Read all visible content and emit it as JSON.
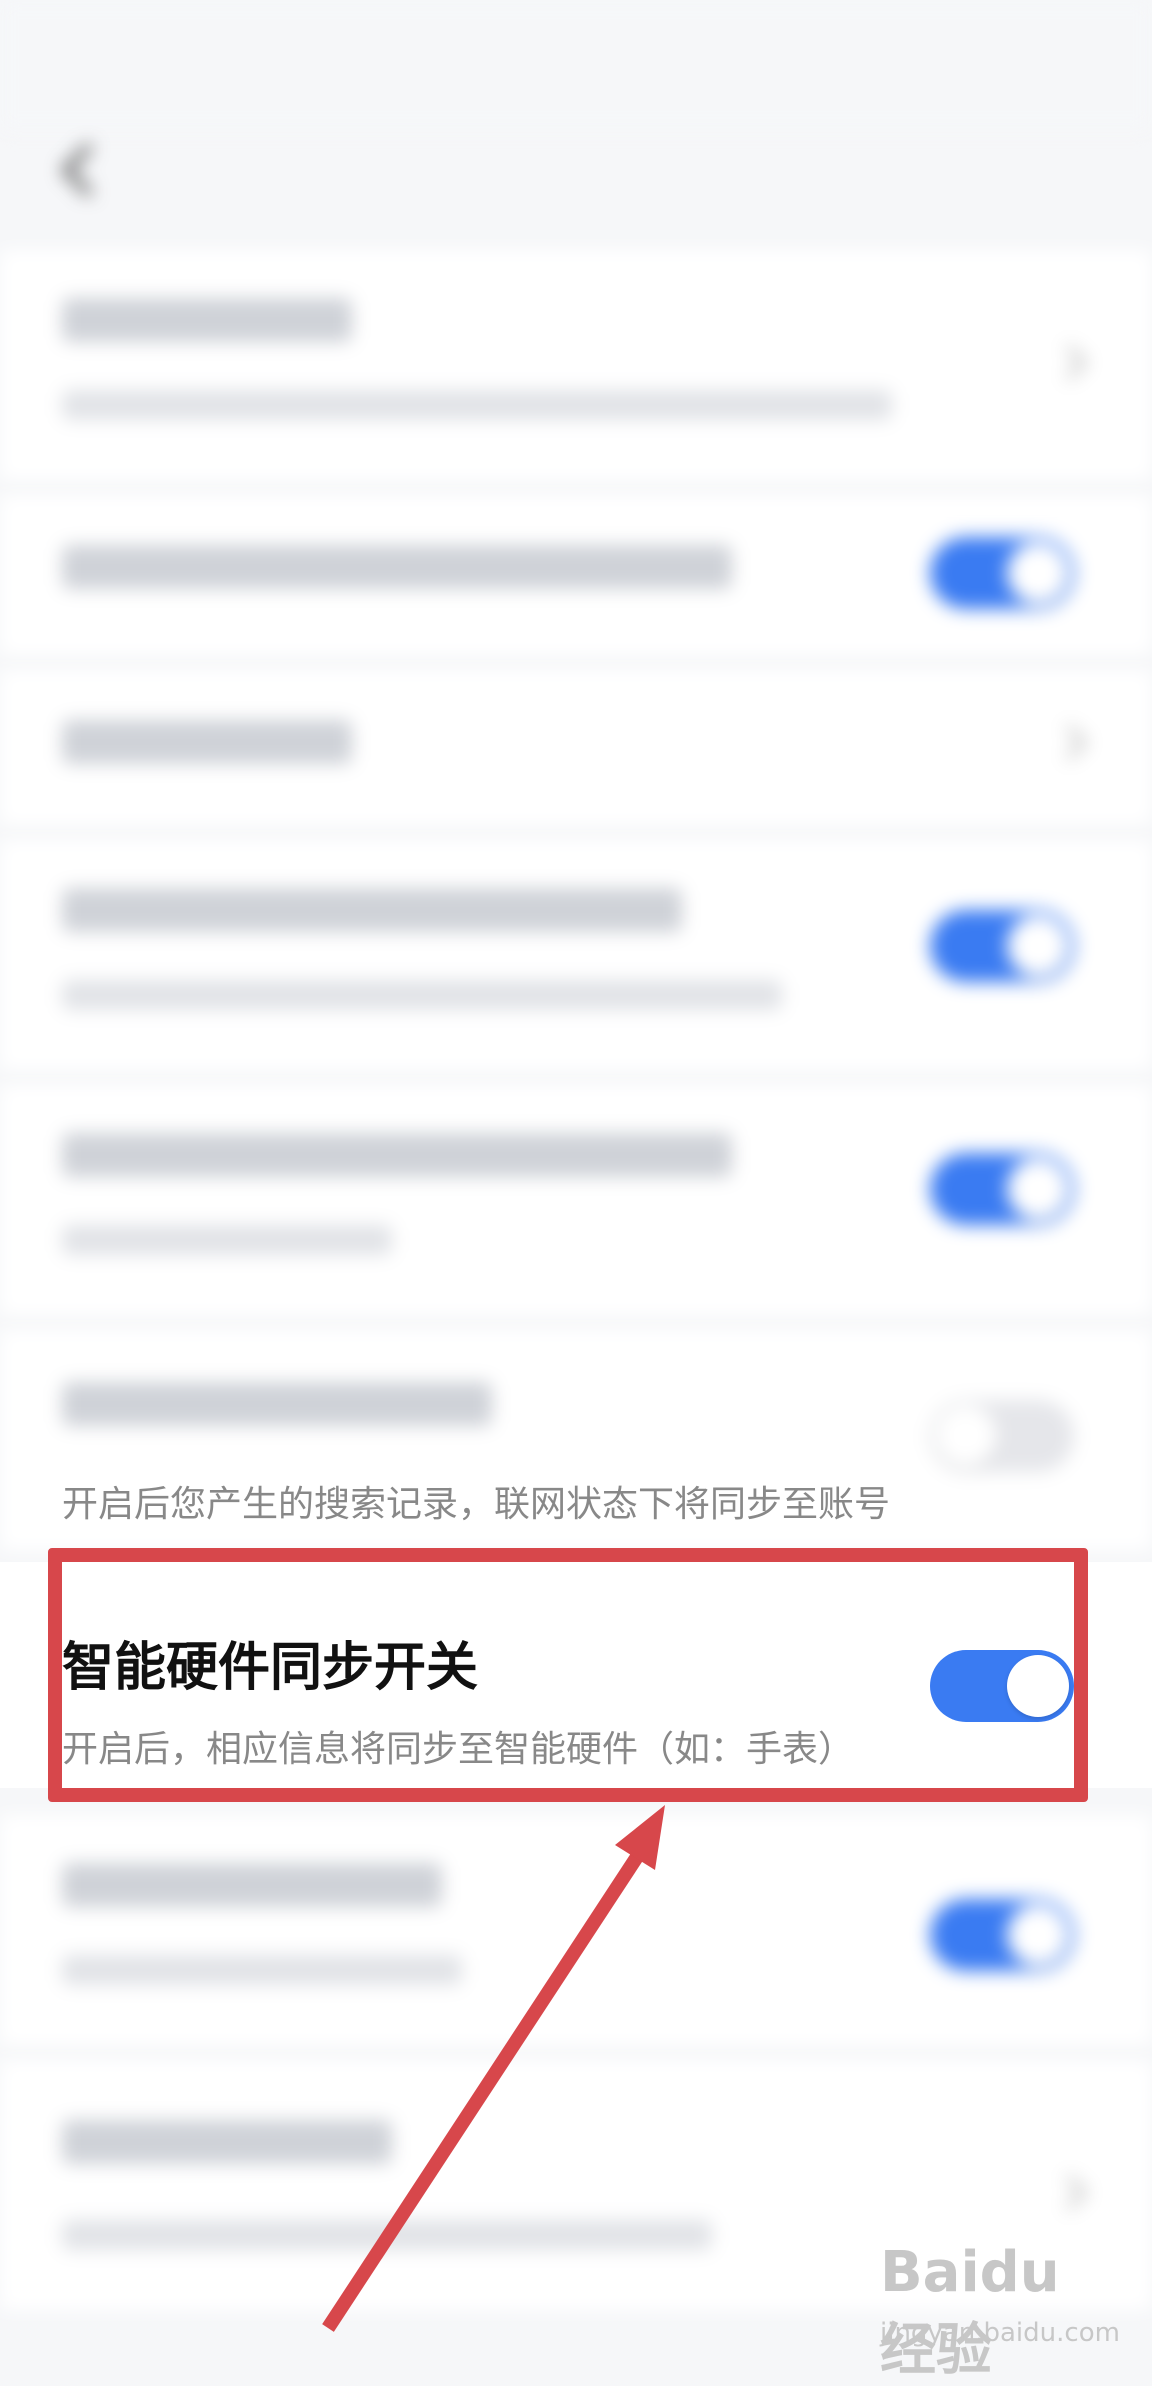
{
  "status_bar": {
    "left_text": "",
    "right_text": ""
  },
  "header": {
    "title": ""
  },
  "rows": [
    {
      "title": "",
      "subtitle": "",
      "control": "chevron"
    },
    {
      "title": "",
      "subtitle": "",
      "control": "toggle",
      "on": true
    },
    {
      "title": "",
      "subtitle": "",
      "control": "chevron"
    },
    {
      "title": "",
      "subtitle": "",
      "control": "toggle",
      "on": true
    },
    {
      "title": "",
      "subtitle": "",
      "control": "toggle",
      "on": true
    },
    {
      "title": "",
      "subtitle": "开启后您产生的搜索记录，联网状态下将同步至账号",
      "control": "toggle",
      "on": false
    },
    {
      "title": "智能硬件同步开关",
      "subtitle": "开启后，相应信息将同步至智能硬件（如：手表）",
      "control": "toggle",
      "on": true
    },
    {
      "title": "",
      "subtitle": "",
      "control": "toggle",
      "on": true
    },
    {
      "title": "",
      "subtitle": "",
      "control": "chevron"
    }
  ],
  "colors": {
    "accent": "#3a7bf2",
    "highlight": "#d7474b",
    "toggle_off": "#e5e6ea"
  },
  "watermark": {
    "brand": "Baidu经验",
    "url": "jingyan.baidu.com"
  }
}
